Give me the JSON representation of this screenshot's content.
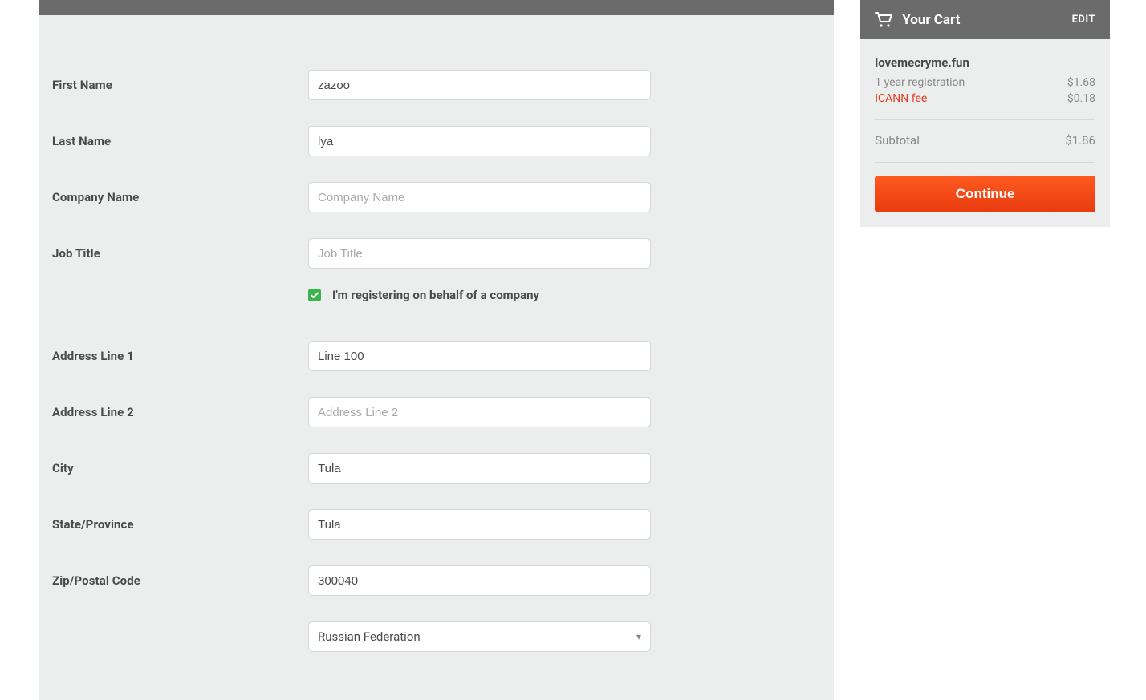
{
  "form": {
    "first_name": {
      "label": "First Name",
      "value": "zazoo",
      "placeholder": ""
    },
    "last_name": {
      "label": "Last Name",
      "value": "lya",
      "placeholder": ""
    },
    "company_name": {
      "label": "Company Name",
      "value": "",
      "placeholder": "Company Name"
    },
    "job_title": {
      "label": "Job Title",
      "value": "",
      "placeholder": "Job Title"
    },
    "company_checkbox": {
      "label": "I'm registering on behalf of a company",
      "checked": true
    },
    "address1": {
      "label": "Address Line 1",
      "value": "Line 100",
      "placeholder": ""
    },
    "address2": {
      "label": "Address Line 2",
      "value": "",
      "placeholder": "Address Line 2"
    },
    "city": {
      "label": "City",
      "value": "Tula",
      "placeholder": ""
    },
    "state": {
      "label": "State/Province",
      "value": "Tula",
      "placeholder": ""
    },
    "zip": {
      "label": "Zip/Postal Code",
      "value": "300040",
      "placeholder": ""
    },
    "country": {
      "label": "",
      "value": "Russian Federation"
    }
  },
  "cart": {
    "title": "Your Cart",
    "edit": "EDIT",
    "domain": "lovemecryme.fun",
    "reg_label": "1 year registration",
    "reg_price": "$1.68",
    "fee_label": "ICANN fee",
    "fee_price": "$0.18",
    "subtotal_label": "Subtotal",
    "subtotal_price": "$1.86",
    "continue": "Continue"
  }
}
